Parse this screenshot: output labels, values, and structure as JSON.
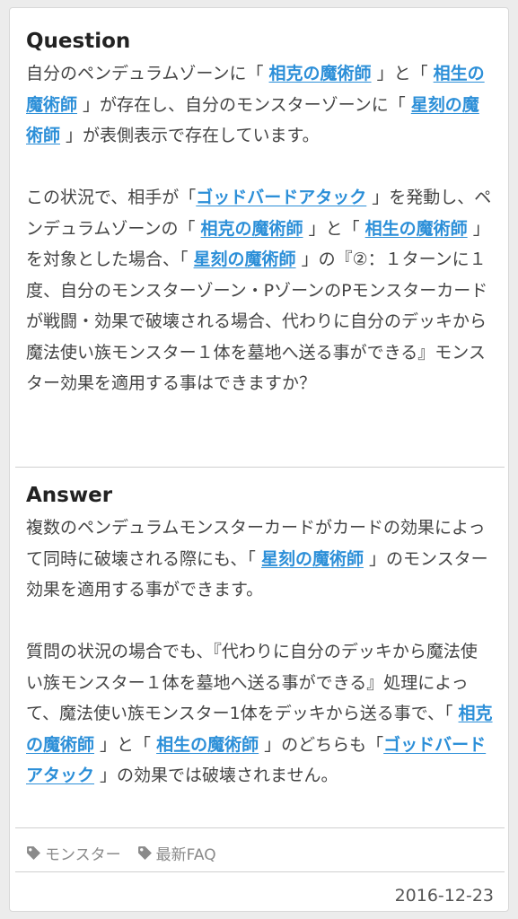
{
  "question": {
    "heading": "Question",
    "para1": [
      {
        "t": "自分のペンデュラムゾーンに「 "
      },
      {
        "t": "相克の魔術師",
        "link": true
      },
      {
        "t": " 」と「 "
      },
      {
        "t": "相生の魔術師",
        "link": true
      },
      {
        "t": " 」が存在し、自分のモンスターゾーンに「 "
      },
      {
        "t": "星刻の魔術師",
        "link": true
      },
      {
        "t": " 」が表側表示で存在しています。"
      }
    ],
    "para2": [
      {
        "t": "この状況で、相手が「"
      },
      {
        "t": "ゴッドバードアタック",
        "link": true
      },
      {
        "t": " 」を発動し、ペンデュラムゾーンの「 "
      },
      {
        "t": "相克の魔術師",
        "link": true
      },
      {
        "t": " 」と「 "
      },
      {
        "t": "相生の魔術師",
        "link": true
      },
      {
        "t": " 」を対象とした場合、「 "
      },
      {
        "t": "星刻の魔術師",
        "link": true
      },
      {
        "t": " 」の『②：１ターンに１度、自分のモンスターゾーン・PゾーンのPモンスターカードが戦闘・効果で破壊される場合、代わりに自分のデッキから魔法使い族モンスター１体を墓地へ送る事ができる』モンスター効果を適用する事はできますか？"
      }
    ]
  },
  "answer": {
    "heading": "Answer",
    "para1": [
      {
        "t": "複数のペンデュラムモンスターカードがカードの効果によって同時に破壊される際にも、「 "
      },
      {
        "t": "星刻の魔術師",
        "link": true
      },
      {
        "t": " 」のモンスター効果を適用する事ができます。"
      }
    ],
    "para2": [
      {
        "t": "質問の状況の場合でも、『代わりに自分のデッキから魔法使い族モンスター１体を墓地へ送る事ができる』処理によって、魔法使い族モンスター1体をデッキから送る事で、「 "
      },
      {
        "t": "相克の魔術師",
        "link": true
      },
      {
        "t": " 」と「 "
      },
      {
        "t": "相生の魔術師",
        "link": true
      },
      {
        "t": " 」のどちらも「"
      },
      {
        "t": "ゴッドバードアタック",
        "link": true
      },
      {
        "t": " 」の効果では破壊されません。"
      }
    ]
  },
  "tags": [
    {
      "label": "モンスター",
      "icon": "tag-icon"
    },
    {
      "label": "最新FAQ",
      "icon": "tag-icon"
    }
  ],
  "date": "2016-12-23",
  "colors": {
    "link": "#2c8fd8",
    "text": "#444444",
    "tag": "#8a8a8a"
  }
}
